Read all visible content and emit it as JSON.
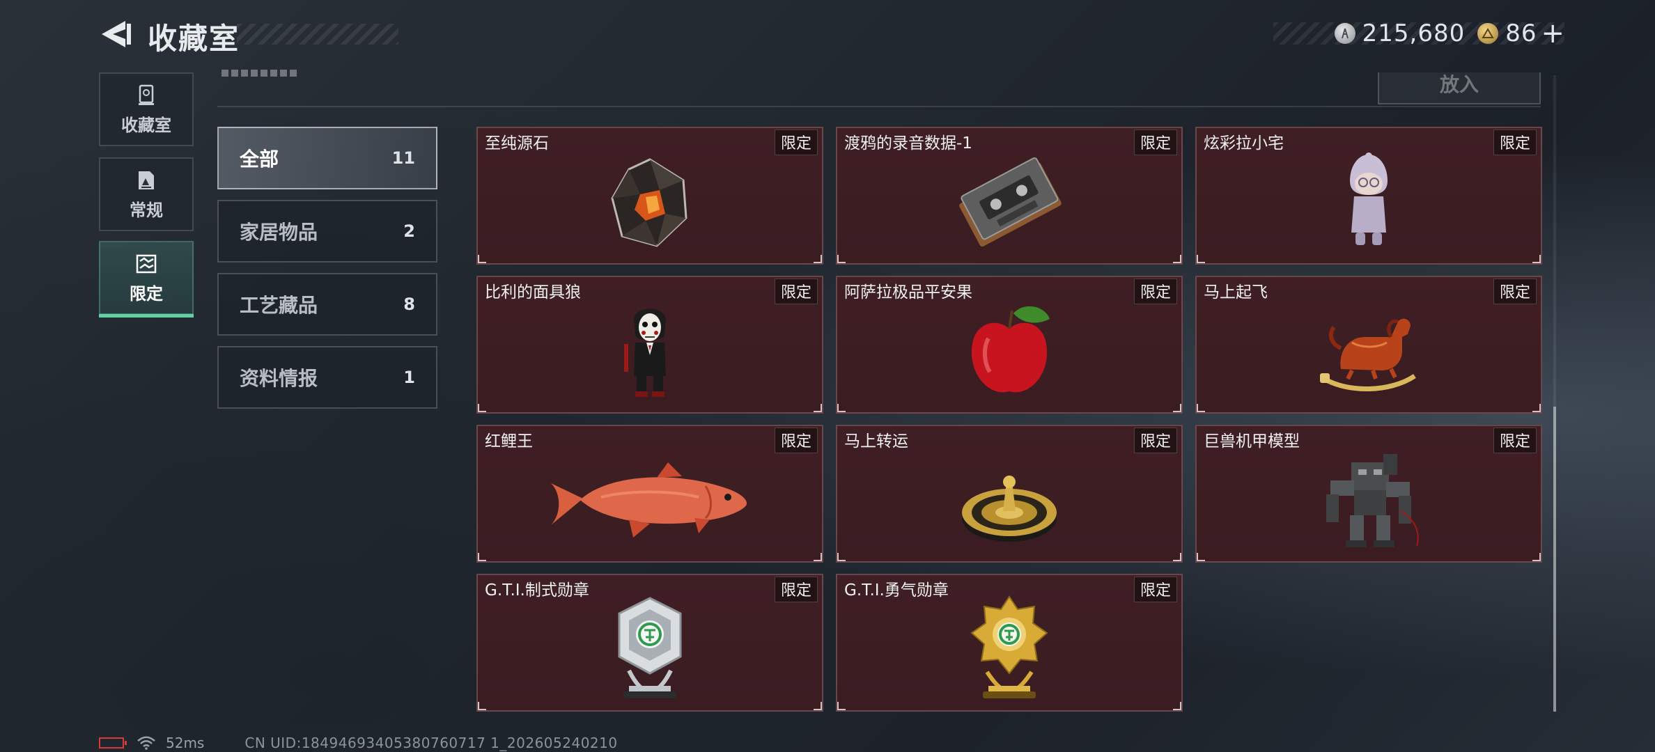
{
  "header": {
    "title": "收藏室",
    "currency": [
      {
        "icon": "silver-coin-icon",
        "value": "215,680"
      },
      {
        "icon": "gold-triangle-coin-icon",
        "value": "86"
      }
    ],
    "plus_label": "+"
  },
  "rail": {
    "tabs": [
      {
        "label": "收藏室",
        "icon": "trophy-icon",
        "active": false
      },
      {
        "label": "常规",
        "icon": "document-icon",
        "active": false
      },
      {
        "label": "限定",
        "icon": "map-icon",
        "active": true
      }
    ]
  },
  "toolbar": {
    "place_label": "放入"
  },
  "categories": [
    {
      "name": "全部",
      "count": "11",
      "active": true
    },
    {
      "name": "家居物品",
      "count": "2",
      "active": false
    },
    {
      "name": "工艺藏品",
      "count": "8",
      "active": false
    },
    {
      "name": "资料情报",
      "count": "1",
      "active": false
    }
  ],
  "items": [
    {
      "name": "至纯源石",
      "badge": "限定",
      "icon": "crystal-stone-icon"
    },
    {
      "name": "渡鸦的录音数据-1",
      "badge": "限定",
      "icon": "cassette-tape-icon"
    },
    {
      "name": "炫彩拉小宅",
      "badge": "限定",
      "icon": "figurine-icon"
    },
    {
      "name": "比利的面具狼",
      "badge": "限定",
      "icon": "puppet-figure-icon"
    },
    {
      "name": "阿萨拉极品平安果",
      "badge": "限定",
      "icon": "apple-icon"
    },
    {
      "name": "马上起飞",
      "badge": "限定",
      "icon": "rocking-horse-icon"
    },
    {
      "name": "红鲤王",
      "badge": "限定",
      "icon": "carp-fish-icon"
    },
    {
      "name": "马上转运",
      "badge": "限定",
      "icon": "golden-compass-icon"
    },
    {
      "name": "巨兽机甲模型",
      "badge": "限定",
      "icon": "mech-model-icon"
    },
    {
      "name": "G.T.I.制式勋章",
      "badge": "限定",
      "icon": "silver-medal-icon"
    },
    {
      "name": "G.T.I.勇气勋章",
      "badge": "限定",
      "icon": "gold-medal-icon"
    }
  ],
  "footer": {
    "ping": "52ms",
    "uid": "CN UID:18494693405380760717 1_202605240210"
  }
}
